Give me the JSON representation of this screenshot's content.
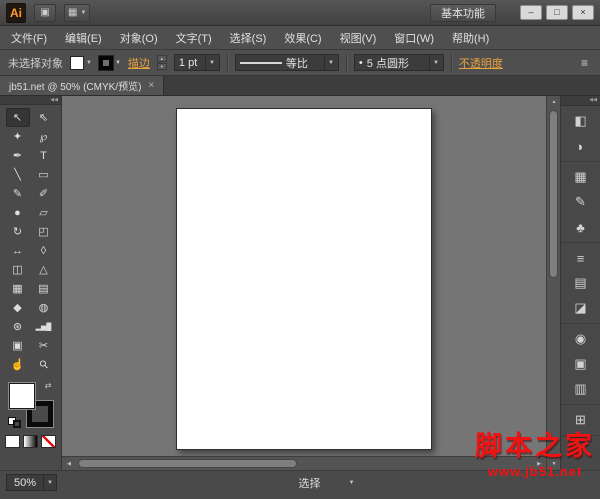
{
  "titlebar": {
    "logo": "Ai",
    "bridge_icon": "▣",
    "arrange_icon": "▦",
    "workspace": "基本功能",
    "minimize": "–",
    "maximize": "□",
    "close": "×"
  },
  "menubar": {
    "items": [
      "文件(F)",
      "编辑(E)",
      "对象(O)",
      "文字(T)",
      "选择(S)",
      "效果(C)",
      "视图(V)",
      "窗口(W)",
      "帮助(H)"
    ]
  },
  "controlbar": {
    "no_selection": "未选择对象",
    "stroke_label": "描边",
    "stroke_weight": "1 pt",
    "profile_label": "等比",
    "brush_bullet": "•",
    "brush_label": "5 点圆形",
    "opacity_label": "不透明度",
    "panel_icon": "≡"
  },
  "tabbar": {
    "tab": {
      "title": "jb51.net @ 50% (CMYK/预览)",
      "close": "×"
    }
  },
  "toolbox": {
    "tools": [
      {
        "name": "selection-tool",
        "glyph": "↖",
        "active": true
      },
      {
        "name": "direct-selection-tool",
        "glyph": "⇖"
      },
      {
        "name": "magic-wand-tool",
        "glyph": "✦"
      },
      {
        "name": "lasso-tool",
        "glyph": "℘"
      },
      {
        "name": "pen-tool",
        "glyph": "✒"
      },
      {
        "name": "type-tool",
        "glyph": "T"
      },
      {
        "name": "line-segment-tool",
        "glyph": "╲"
      },
      {
        "name": "rectangle-tool",
        "glyph": "▭"
      },
      {
        "name": "paintbrush-tool",
        "glyph": "✎"
      },
      {
        "name": "pencil-tool",
        "glyph": "✐"
      },
      {
        "name": "blob-brush-tool",
        "glyph": "●"
      },
      {
        "name": "eraser-tool",
        "glyph": "▱"
      },
      {
        "name": "rotate-tool",
        "glyph": "↻"
      },
      {
        "name": "scale-tool",
        "glyph": "◰"
      },
      {
        "name": "width-tool",
        "glyph": "↔"
      },
      {
        "name": "free-transform-tool",
        "glyph": "◊"
      },
      {
        "name": "shape-builder-tool",
        "glyph": "◫"
      },
      {
        "name": "perspective-grid-tool",
        "glyph": "△"
      },
      {
        "name": "mesh-tool",
        "glyph": "▦"
      },
      {
        "name": "gradient-tool",
        "glyph": "▤"
      },
      {
        "name": "eyedropper-tool",
        "glyph": "◆"
      },
      {
        "name": "blend-tool",
        "glyph": "◍"
      },
      {
        "name": "symbol-sprayer-tool",
        "glyph": "⊛"
      },
      {
        "name": "column-graph-tool",
        "glyph": "▂▅█"
      },
      {
        "name": "artboard-tool",
        "glyph": "▣"
      },
      {
        "name": "slice-tool",
        "glyph": "✂"
      },
      {
        "name": "hand-tool",
        "glyph": "☝"
      },
      {
        "name": "zoom-tool",
        "glyph": "⚲"
      }
    ]
  },
  "dock": {
    "groups": [
      [
        {
          "name": "color",
          "glyph": "◧"
        },
        {
          "name": "color-guide",
          "glyph": "◗"
        }
      ],
      [
        {
          "name": "swatches",
          "glyph": "▦"
        },
        {
          "name": "brushes",
          "glyph": "✎"
        },
        {
          "name": "symbols",
          "glyph": "♣"
        }
      ],
      [
        {
          "name": "stroke",
          "glyph": "≡"
        },
        {
          "name": "gradient",
          "glyph": "▤"
        },
        {
          "name": "transparency",
          "glyph": "◪"
        }
      ],
      [
        {
          "name": "appearance",
          "glyph": "◉"
        },
        {
          "name": "graphic-styles",
          "glyph": "▣"
        },
        {
          "name": "layers",
          "glyph": "▥"
        }
      ],
      [
        {
          "name": "artboards",
          "glyph": "⊞"
        }
      ]
    ]
  },
  "statusbar": {
    "zoom": "50%",
    "status": "选择"
  },
  "watermark": {
    "title": "脚本之家",
    "url": "www.jb51.net"
  },
  "glyphs": {
    "caret": "▼",
    "up": "▲",
    "down": "▼",
    "left": "◀",
    "right": "▶",
    "swap": "⇄",
    "collapse": "◀◀"
  },
  "colors": {
    "chrome": "#4a4a4a",
    "canvas": "#757575",
    "artboard": "#ffffff",
    "fill": "#ffffff",
    "stroke": "#000000",
    "accent_link": "#e8a33d",
    "watermark_red": "#f31212"
  }
}
